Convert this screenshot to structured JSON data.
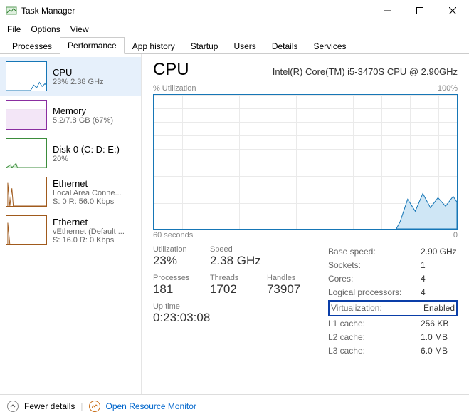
{
  "window": {
    "title": "Task Manager"
  },
  "menu": {
    "file": "File",
    "options": "Options",
    "view": "View"
  },
  "tabs": {
    "processes": "Processes",
    "performance": "Performance",
    "app_history": "App history",
    "startup": "Startup",
    "users": "Users",
    "details": "Details",
    "services": "Services"
  },
  "sidebar": {
    "cpu": {
      "name": "CPU",
      "sub": "23%  2.38 GHz"
    },
    "memory": {
      "name": "Memory",
      "sub": "5.2/7.8 GB (67%)"
    },
    "disk": {
      "name": "Disk 0 (C: D: E:)",
      "sub": "20%"
    },
    "eth1": {
      "name": "Ethernet",
      "sub": "Local Area Conne...",
      "sub2": "S: 0 R: 56.0 Kbps"
    },
    "eth2": {
      "name": "Ethernet",
      "sub": "vEthernet (Default ...",
      "sub2": "S: 16.0 R: 0 Kbps"
    }
  },
  "main": {
    "heading": "CPU",
    "model": "Intel(R) Core(TM) i5-3470S CPU @ 2.90GHz",
    "yaxis_label": "% Utilization",
    "ymax": "100%",
    "xaxis_left": "60 seconds",
    "xaxis_right": "0",
    "left_stats": {
      "util_l": "Utilization",
      "speed_l": "Speed",
      "util_v": "23%",
      "speed_v": "2.38 GHz",
      "proc_l": "Processes",
      "thr_l": "Threads",
      "hnd_l": "Handles",
      "proc_v": "181",
      "thr_v": "1702",
      "hnd_v": "73907",
      "uptime_l": "Up time",
      "uptime_v": "0:23:03:08"
    },
    "right_stats": {
      "base_k": "Base speed:",
      "base_v": "2.90 GHz",
      "sock_k": "Sockets:",
      "sock_v": "1",
      "cores_k": "Cores:",
      "cores_v": "4",
      "lp_k": "Logical processors:",
      "lp_v": "4",
      "virt_k": "Virtualization:",
      "virt_v": "Enabled",
      "l1_k": "L1 cache:",
      "l1_v": "256 KB",
      "l2_k": "L2 cache:",
      "l2_v": "1.0 MB",
      "l3_k": "L3 cache:",
      "l3_v": "6.0 MB"
    }
  },
  "footer": {
    "fewer": "Fewer details",
    "orm": "Open Resource Monitor"
  },
  "chart_data": {
    "type": "line",
    "title": "CPU % Utilization",
    "xlabel": "seconds ago",
    "ylabel": "% Utilization",
    "ylim": [
      0,
      100
    ],
    "xlim": [
      60,
      0
    ],
    "x": [
      60,
      55,
      50,
      45,
      40,
      35,
      30,
      25,
      20,
      15,
      12,
      10,
      8,
      6,
      5,
      4,
      3,
      2,
      1,
      0
    ],
    "values": [
      0,
      0,
      0,
      0,
      0,
      0,
      0,
      0,
      0,
      0,
      0,
      5,
      22,
      14,
      26,
      16,
      23,
      17,
      24,
      20
    ]
  }
}
